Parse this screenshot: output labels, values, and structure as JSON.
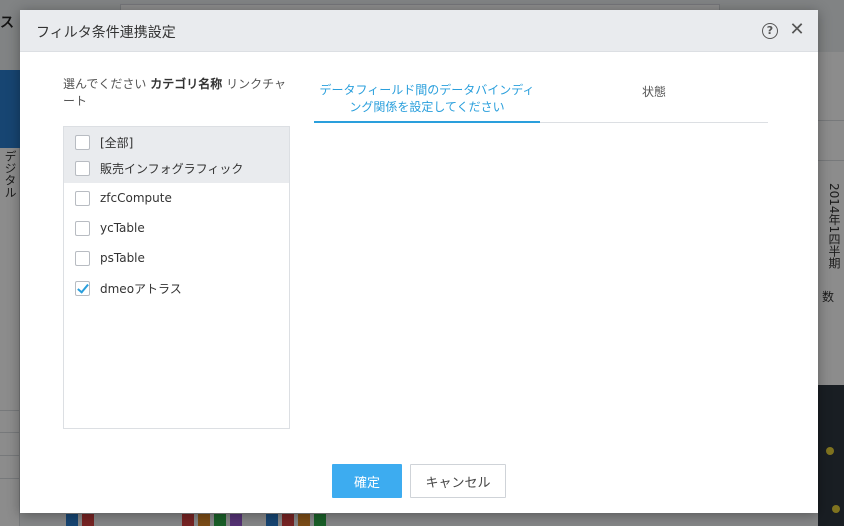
{
  "background": {
    "topbar_mark": "ス",
    "left_vertical_text": "デジタル",
    "right_vertical_text": "2014年1四半期",
    "right_number_label": "数"
  },
  "dialog": {
    "title": "フィルタ条件連携設定",
    "help_icon": "?",
    "close_icon": "✕",
    "select_label_prefix": "選んでください",
    "select_label_bold": "カテゴリ名称",
    "select_label_suffix": "リンクチャート",
    "items": [
      {
        "label": "[全部]",
        "checked": false
      },
      {
        "label": "販売インフォグラフィック",
        "checked": false
      },
      {
        "label": "zfcCompute",
        "checked": false
      },
      {
        "label": "ycTable",
        "checked": false
      },
      {
        "label": "psTable",
        "checked": false
      },
      {
        "label": "dmeoアトラス",
        "checked": true
      }
    ],
    "tabs": [
      {
        "label": "データフィールド間のデータバインディング関係を設定してください",
        "active": true
      },
      {
        "label": "状態",
        "active": false
      }
    ],
    "confirm_label": "確定",
    "cancel_label": "キャンセル"
  },
  "colors": {
    "accent": "#2a9fdc",
    "confirm_button": "#3dacf0",
    "header_bg": "#e9ebee"
  }
}
